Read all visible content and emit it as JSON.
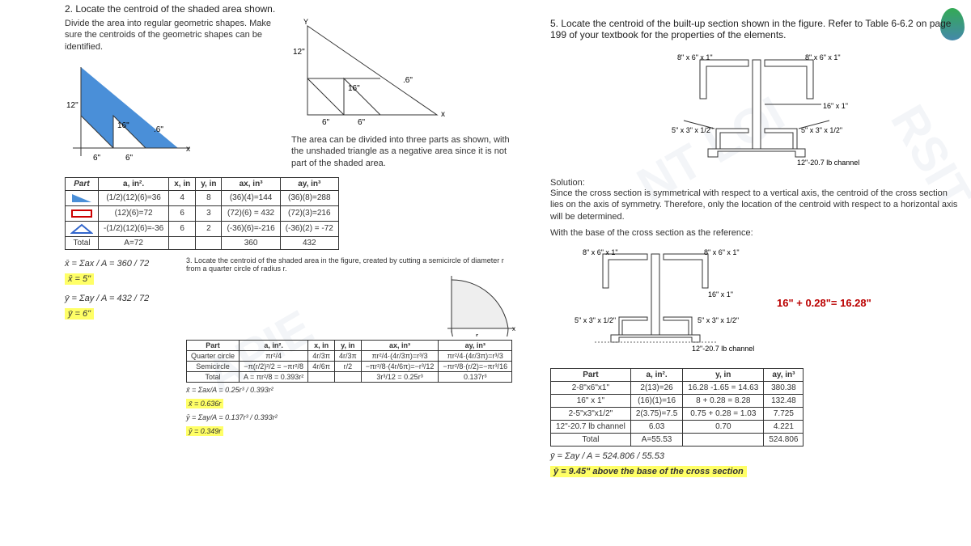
{
  "p2": {
    "title": "2.  Locate the centroid of the shaded area shown.",
    "instr": "Divide the area into regular geometric shapes. Make sure the centroids of the geometric shapes can be identified.",
    "diag1": {
      "h": "12\"",
      "b1": "6\"",
      "b2": "6\"",
      "mid": "16\"",
      "side": ".6\""
    },
    "diag2": {
      "top": "12\"",
      "mid": "16\"",
      "r": ".6\"",
      "base1": "6\"",
      "base2": "6\"",
      "note": "The area can be divided into three parts as shown, with the unshaded triangle as a negative area since it is not part of the shaded area."
    },
    "table": {
      "hdr": [
        "Part",
        "a, in².",
        "x, in",
        "y, in",
        "ax, in³",
        "ay, in³"
      ],
      "rows": [
        [
          "",
          "(1/2)(12)(6)=36",
          "4",
          "8",
          "(36)(4)=144",
          "(36)(8)=288"
        ],
        [
          "",
          "(12)(6)=72",
          "6",
          "3",
          "(72)(6) = 432",
          "(72)(3)=216"
        ],
        [
          "",
          "-(1/2)(12)(6)=-36",
          "6",
          "2",
          "(-36)(6)=-216",
          "(-36)(2) = -72"
        ]
      ],
      "tot": [
        "Total",
        "A=72",
        "",
        "",
        "360",
        "432"
      ]
    },
    "eqs": {
      "x": "x̄ = Σax / A = 360 / 72",
      "xr": "x̄ = 5\"",
      "y": "ȳ = Σay / A = 432 / 72",
      "yr": "ȳ = 6\""
    }
  },
  "p3": {
    "title": "3.  Locate the centroid of the shaded area in the figure, created by cutting a semicircle of diameter r from a quarter circle of radius r.",
    "table": {
      "hdr": [
        "Part",
        "a, in².",
        "x, in",
        "y, in",
        "ax, in³",
        "ay, in³"
      ],
      "rows": [
        [
          "Quarter circle",
          "πr²/4",
          "4r/3π",
          "4r/3π",
          "πr²/4·(4r/3π)=r³/3",
          "πr²/4·(4r/3π)=r³/3"
        ],
        [
          "Semicircle",
          "−π(r/2)²/2 = −πr²/8",
          "4r/6π",
          "r/2",
          "−πr²/8·(4r/6π)=−r³/12",
          "−πr²/8·(r/2)=−πr³/16"
        ]
      ],
      "tot": [
        "Total",
        "A = πr²/8 = 0.393r²",
        "",
        "",
        "3r³/12 = 0.25r³",
        "0.137r³"
      ]
    },
    "eqs": {
      "x": "x̄ = Σax/A = 0.25r³ / 0.393r²",
      "xr": "x̄ = 0.636r",
      "y": "ȳ = Σay/A = 0.137r³ / 0.393r²",
      "yr": "ȳ = 0.349r"
    }
  },
  "p5": {
    "title": "5.  Locate the centroid of the built-up section shown in the figure. Refer to Table 6-6.2 on page 199 of your textbook for the properties of the elements.",
    "labels": {
      "topL": "8\" x 6\" x 1\"",
      "topR": "8\" x 6\" x 1\"",
      "web": "16\" x 1\"",
      "botL": "5\" x 3\" x 1/2\"",
      "botR": "5\" x 3\" x 1/2\"",
      "chan": "12\"-20.7 lb channel"
    },
    "sol": {
      "head": "Solution:",
      "p1": "Since the cross section is symmetrical with respect to a vertical axis, the centroid of the cross section lies on the axis of symmetry. Therefore, only the location of the centroid with respect to a horizontal axis will be determined.",
      "p2": "With the base of the cross section as the reference:"
    },
    "dim": "16\" + 0.28\"= 16.28\"",
    "table": {
      "hdr": [
        "Part",
        "a, in².",
        "y, in",
        "ay, in³"
      ],
      "rows": [
        [
          "2-8\"x6\"x1\"",
          "2(13)=26",
          "16.28 -1.65 = 14.63",
          "380.38"
        ],
        [
          "16\" x 1\"",
          "(16)(1)=16",
          "8 + 0.28 = 8.28",
          "132.48"
        ],
        [
          "2-5\"x3\"x1/2\"",
          "2(3.75)=7.5",
          "0.75 + 0.28 = 1.03",
          "7.725"
        ],
        [
          "12\"-20.7 lb channel",
          "6.03",
          "0.70",
          "4.221"
        ]
      ],
      "tot": [
        "Total",
        "A=55.53",
        "",
        "524.806"
      ]
    },
    "eqs": {
      "y": "ȳ = Σay / A = 524.806 / 55.53",
      "yr": "ȳ = 9.45\" above the base of the cross section"
    }
  }
}
